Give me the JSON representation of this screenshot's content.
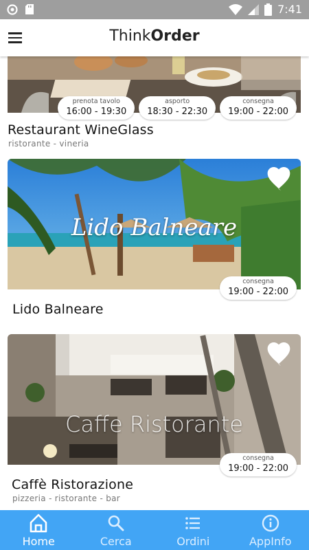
{
  "status_bar": {
    "time": "7:41"
  },
  "app_bar": {
    "title_light": "Think",
    "title_bold": "Order"
  },
  "restaurants": [
    {
      "name": "Restaurant WineGlass",
      "subtitle": "ristorante - vineria",
      "services": [
        {
          "label": "prenota tavolo",
          "hours": "16:00 - 19:30"
        },
        {
          "label": "asporto",
          "hours": "18:30 - 22:30"
        },
        {
          "label": "consegna",
          "hours": "19:00 - 22:00"
        }
      ]
    },
    {
      "name": "Lido Balneare",
      "image_caption": "Lido Balneare",
      "subtitle": "",
      "services": [
        {
          "label": "consegna",
          "hours": "19:00 - 22:00"
        }
      ]
    },
    {
      "name": "Caffè Ristorazione",
      "image_caption": "Caffe Ristorante",
      "subtitle": "pizzeria - ristorante - bar",
      "services": [
        {
          "label": "consegna",
          "hours": "19:00 - 22:00"
        }
      ]
    }
  ],
  "bottom_nav": [
    {
      "label": "Home",
      "icon": "home-icon",
      "active": true
    },
    {
      "label": "Cerca",
      "icon": "search-icon",
      "active": false
    },
    {
      "label": "Ordini",
      "icon": "list-icon",
      "active": false
    },
    {
      "label": "AppInfo",
      "icon": "info-icon",
      "active": false
    }
  ],
  "colors": {
    "nav_bg": "#42a5f5",
    "status_bar": "#9e9e9e",
    "nav_active": "#ffffff"
  }
}
